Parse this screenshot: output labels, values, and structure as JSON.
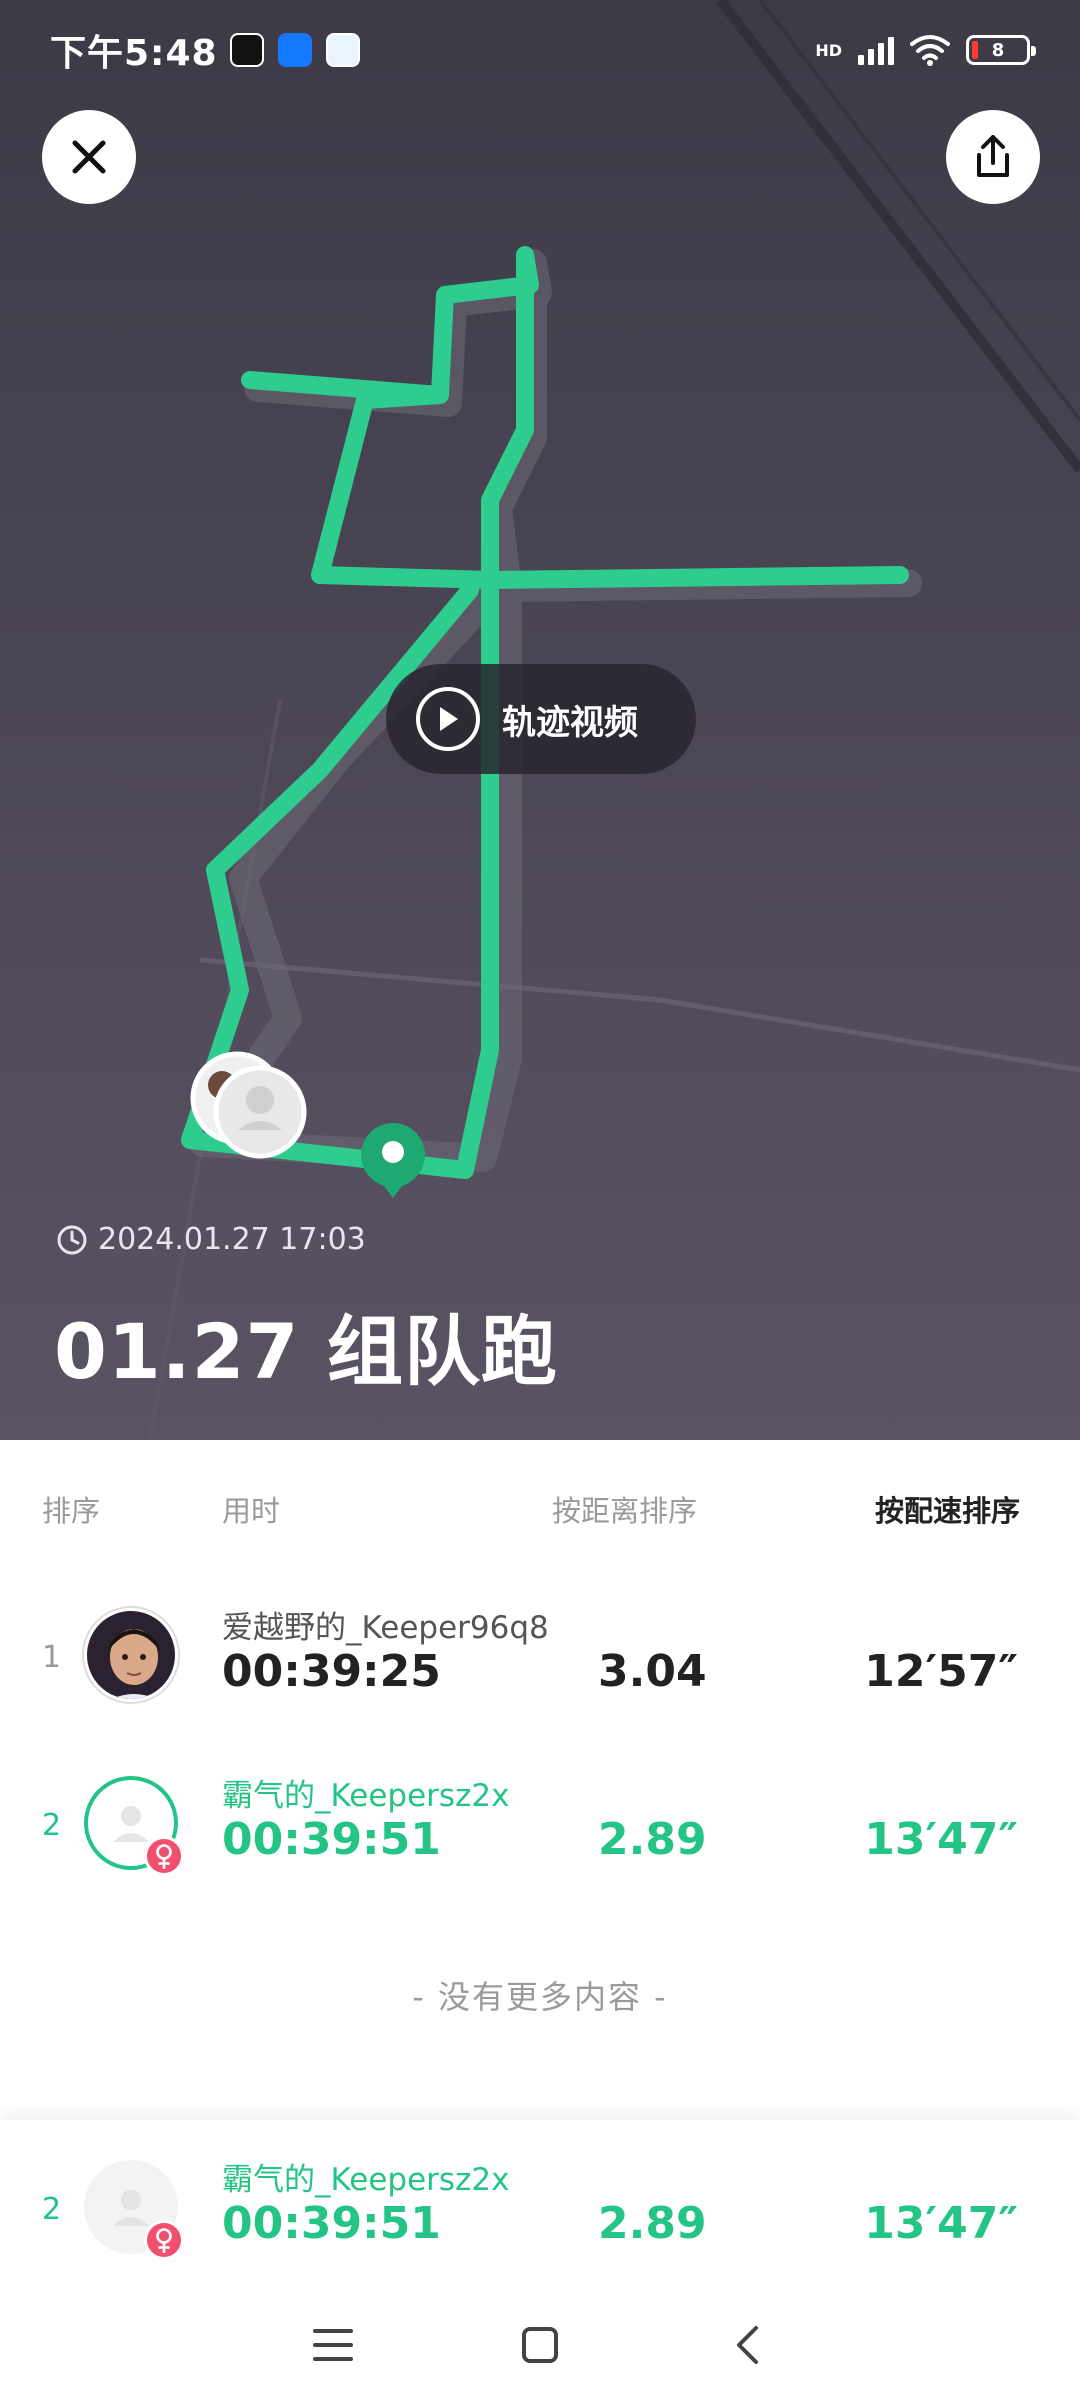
{
  "status_bar": {
    "time": "下午5:48",
    "network_label": "HD",
    "battery": "8"
  },
  "map": {
    "video_button_label": "轨迹视频",
    "date": "2024.01.27 17:03",
    "title": "01.27 组队跑",
    "route_color": "#2ecc8f"
  },
  "ranking": {
    "headers": {
      "rank": "排序",
      "time": "用时",
      "sort_distance": "按距离排序",
      "sort_pace": "按配速排序"
    },
    "rows": [
      {
        "rank": "1",
        "name": "爱越野的_Keeper96q8",
        "time": "00:39:25",
        "distance": "3.04",
        "pace": "12′57″"
      },
      {
        "rank": "2",
        "name": "霸气的_Keepersz2x",
        "time": "00:39:51",
        "distance": "2.89",
        "pace": "13′47″"
      }
    ],
    "no_more": "- 没有更多内容 -",
    "accent_color": "#24c486"
  },
  "my_row": {
    "rank": "2",
    "name": "霸气的_Keepersz2x",
    "time": "00:39:51",
    "distance": "2.89",
    "pace": "13′47″"
  }
}
